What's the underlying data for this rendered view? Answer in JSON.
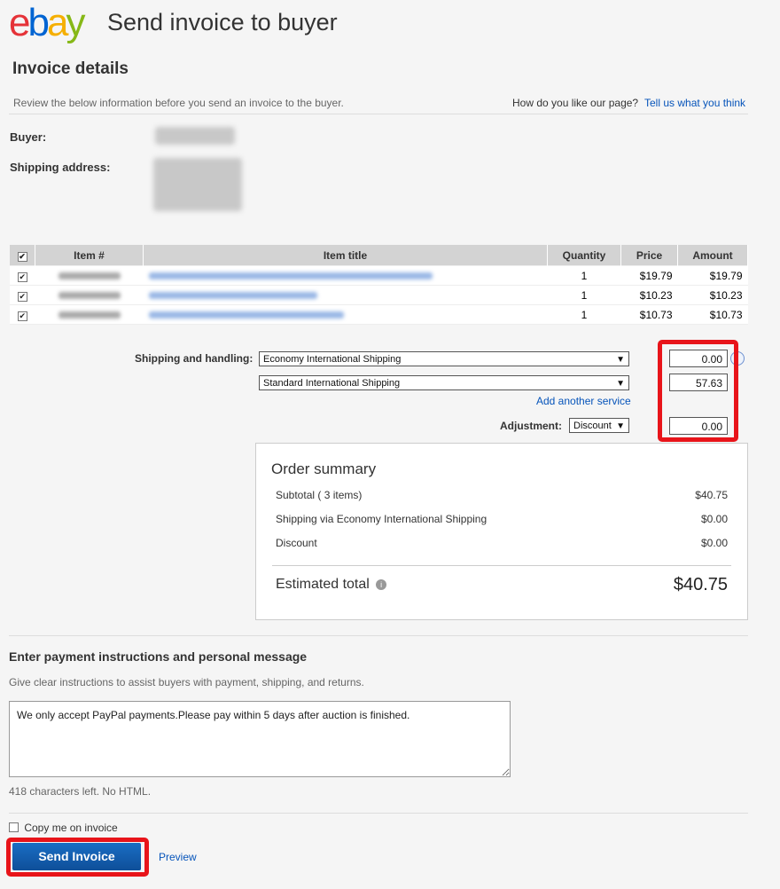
{
  "logo": {
    "letters": [
      "e",
      "b",
      "a",
      "y"
    ]
  },
  "page_title": "Send invoice to buyer",
  "section_title": "Invoice details",
  "review_text": "Review the below information before you send an invoice to the buyer.",
  "feedback": {
    "question": "How do you like our page?",
    "link": "Tell us what you think"
  },
  "buyer": {
    "label": "Buyer:",
    "shipping_label": "Shipping address:"
  },
  "table": {
    "headers": [
      "Item #",
      "Item title",
      "Quantity",
      "Price",
      "Amount"
    ],
    "rows": [
      {
        "quantity": "1",
        "price": "$19.79",
        "amount": "$19.79"
      },
      {
        "quantity": "1",
        "price": "$10.23",
        "amount": "$10.23"
      },
      {
        "quantity": "1",
        "price": "$10.73",
        "amount": "$10.73"
      }
    ]
  },
  "shipping": {
    "label": "Shipping and handling:",
    "service1": "Economy International Shipping",
    "service1_cost": "0.00",
    "service2": "Standard International Shipping",
    "service2_cost": "57.63",
    "add_link": "Add another service",
    "adjustment_label": "Adjustment:",
    "adjustment_type": "Discount",
    "adjustment_value": "0.00"
  },
  "summary": {
    "title": "Order summary",
    "subtotal_label": "Subtotal ( 3 items)",
    "subtotal_value": "$40.75",
    "shipping_label": "Shipping via Economy International Shipping",
    "shipping_value": "$0.00",
    "discount_label": "Discount",
    "discount_value": "$0.00",
    "total_label": "Estimated total",
    "total_value": "$40.75"
  },
  "message": {
    "title": "Enter payment instructions and personal message",
    "hint": "Give clear instructions to assist buyers with payment, shipping, and returns.",
    "text": "We only accept PayPal payments.Please pay within 5 days after auction is finished.",
    "chars_left": "418 characters left. No HTML."
  },
  "copy_label": "Copy me on invoice",
  "send_label": "Send Invoice",
  "preview_label": "Preview",
  "colors": {
    "accent_red": "#e8141a",
    "link_blue": "#0654ba",
    "button_blue": "#0e5eb0"
  }
}
